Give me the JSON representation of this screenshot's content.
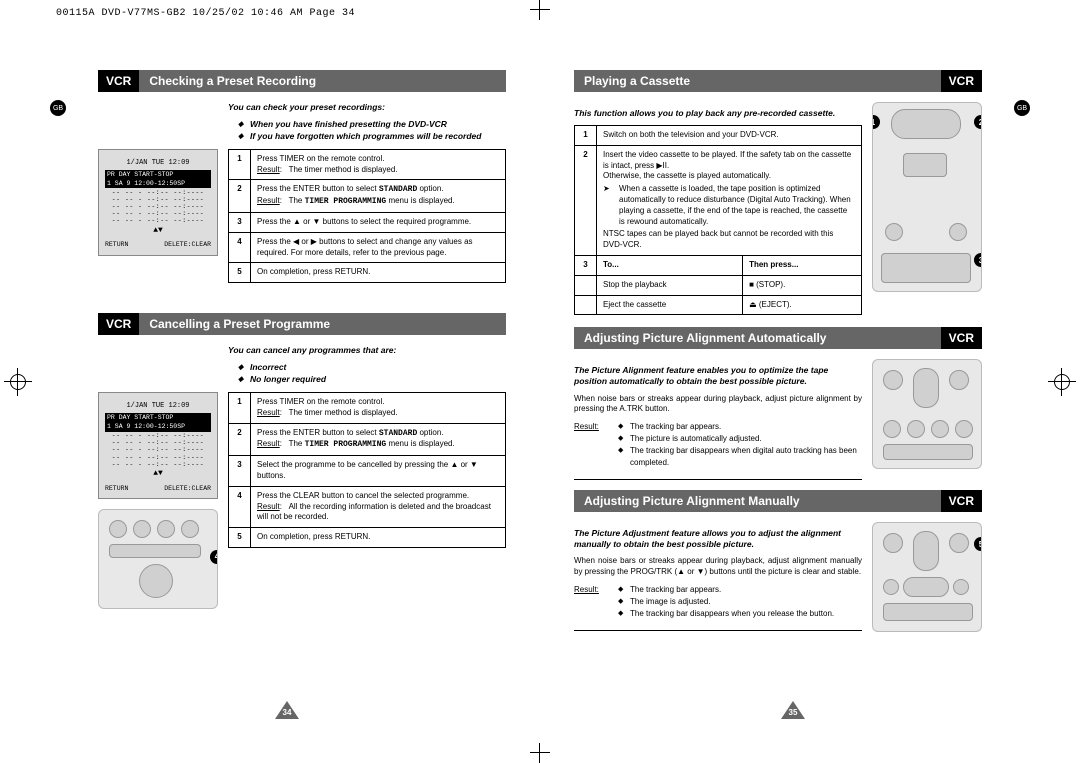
{
  "print_header": "00115A DVD-V77MS-GB2  10/25/02 10:46 AM  Page 34",
  "gb": "GB",
  "page_numbers": {
    "left": "34",
    "right": "35"
  },
  "left": {
    "sec1": {
      "tag": "VCR",
      "title": "Checking a Preset Recording",
      "intro": "You can check your preset recordings:",
      "bullets": [
        "When you have finished presetting the DVD-VCR",
        "If you have forgotten which programmes will be recorded"
      ],
      "lcd": {
        "hdr": "1/JAN TUE   12:09",
        "r1": "PR DAY  START-STOP",
        "r2": " 1 SA 9 12:00-12:50SP",
        "dash": "-- -- - --:-- --:----",
        "ft_left": "RETURN",
        "ft_right": "DELETE:CLEAR",
        "arrows": "▲▼"
      },
      "steps": [
        {
          "n": "1",
          "body": "Press TIMER on the remote control.",
          "result": "The timer method is displayed."
        },
        {
          "n": "2",
          "body": "Press the ENTER button to select ",
          "kw": "STANDARD",
          "body2": " option.",
          "result": "The ",
          "mono": "TIMER PROGRAMMING",
          "result2": " menu is displayed."
        },
        {
          "n": "3",
          "body": "Press the ▲ or ▼ buttons to select the required programme."
        },
        {
          "n": "4",
          "body": "Press the ◀ or ▶ buttons to select and change any values as required. For more details, refer to the previous page."
        },
        {
          "n": "5",
          "body": "On completion, press RETURN."
        }
      ]
    },
    "sec2": {
      "tag": "VCR",
      "title": "Cancelling a Preset Programme",
      "intro": "You can cancel any programmes that are:",
      "bullets": [
        "Incorrect",
        "No longer required"
      ],
      "lcd": {
        "hdr": "1/JAN TUE   12:09",
        "r1": "PR DAY  START-STOP",
        "r2": " 1 SA 9 12:00-12:50SP",
        "dash": "-- -- - --:-- --:----",
        "ft_left": "RETURN",
        "ft_right": "DELETE:CLEAR",
        "arrows": "▲▼"
      },
      "steps": [
        {
          "n": "1",
          "body": "Press TIMER on the remote control.",
          "result": "The timer method is displayed."
        },
        {
          "n": "2",
          "body": "Press the ENTER button to select ",
          "kw": "STANDARD",
          "body2": " option.",
          "result": "The ",
          "mono": "TIMER PROGRAMMING",
          "result2": " menu is displayed."
        },
        {
          "n": "3",
          "body": "Select the programme to be cancelled by pressing the ▲ or ▼ buttons."
        },
        {
          "n": "4",
          "body": "Press the CLEAR button to cancel the selected programme.",
          "result": "All the recording information is deleted and the broadcast will not be recorded."
        },
        {
          "n": "5",
          "body": "On completion, press RETURN."
        }
      ]
    }
  },
  "right": {
    "sec1": {
      "title": "Playing a Cassette",
      "tag": "VCR",
      "intro": "This function allows you to play back any pre-recorded cassette.",
      "steps12": [
        {
          "n": "1",
          "body": "Switch on both the television and your DVD-VCR."
        },
        {
          "n": "2",
          "body": "Insert the video cassette to be played. If the safety tab on the cassette is intact, press ▶II.",
          "otherwise": "Otherwise, the cassette is played automatically.",
          "note": "When a cassette is loaded, the tape position is optimized automatically to reduce disturbance (Digital Auto Tracking). When playing a cassette, if the end of the tape is reached, the cassette is rewound automatically.",
          "ntsc": "NTSC tapes can be played back but cannot be recorded with this DVD-VCR."
        }
      ],
      "step3": {
        "n": "3",
        "h_to": "To...",
        "h_then": "Then press...",
        "rows": [
          {
            "to": "Stop the playback",
            "then": "■ (STOP)."
          },
          {
            "to": "Eject the cassette",
            "then": "⏏ (EJECT)."
          }
        ]
      }
    },
    "sec2": {
      "title": "Adjusting Picture Alignment Automatically",
      "tag": "VCR",
      "intro": "The Picture Alignment feature enables you to optimize the tape position automatically to obtain the best possible picture.",
      "para": "When noise bars or streaks appear during playback, adjust picture alignment by pressing the A.TRK button.",
      "result_label": "Result:",
      "results": [
        "The tracking bar appears.",
        "The picture is automatically adjusted.",
        "The tracking bar disappears when digital auto tracking has been completed."
      ]
    },
    "sec3": {
      "title": "Adjusting Picture Alignment Manually",
      "tag": "VCR",
      "intro": "The Picture Adjustment feature allows you to adjust the alignment manually to obtain the best possible picture.",
      "para": "When noise bars or streaks appear during playback, adjust alignment manually by pressing the PROG/TRK (▲ or ▼) buttons until the picture is clear and stable.",
      "result_label": "Result:",
      "results": [
        "The tracking bar appears.",
        "The image is adjusted.",
        "The tracking bar disappears when you release the button."
      ]
    },
    "callouts": [
      "1",
      "2",
      "3",
      "4",
      "5"
    ]
  }
}
